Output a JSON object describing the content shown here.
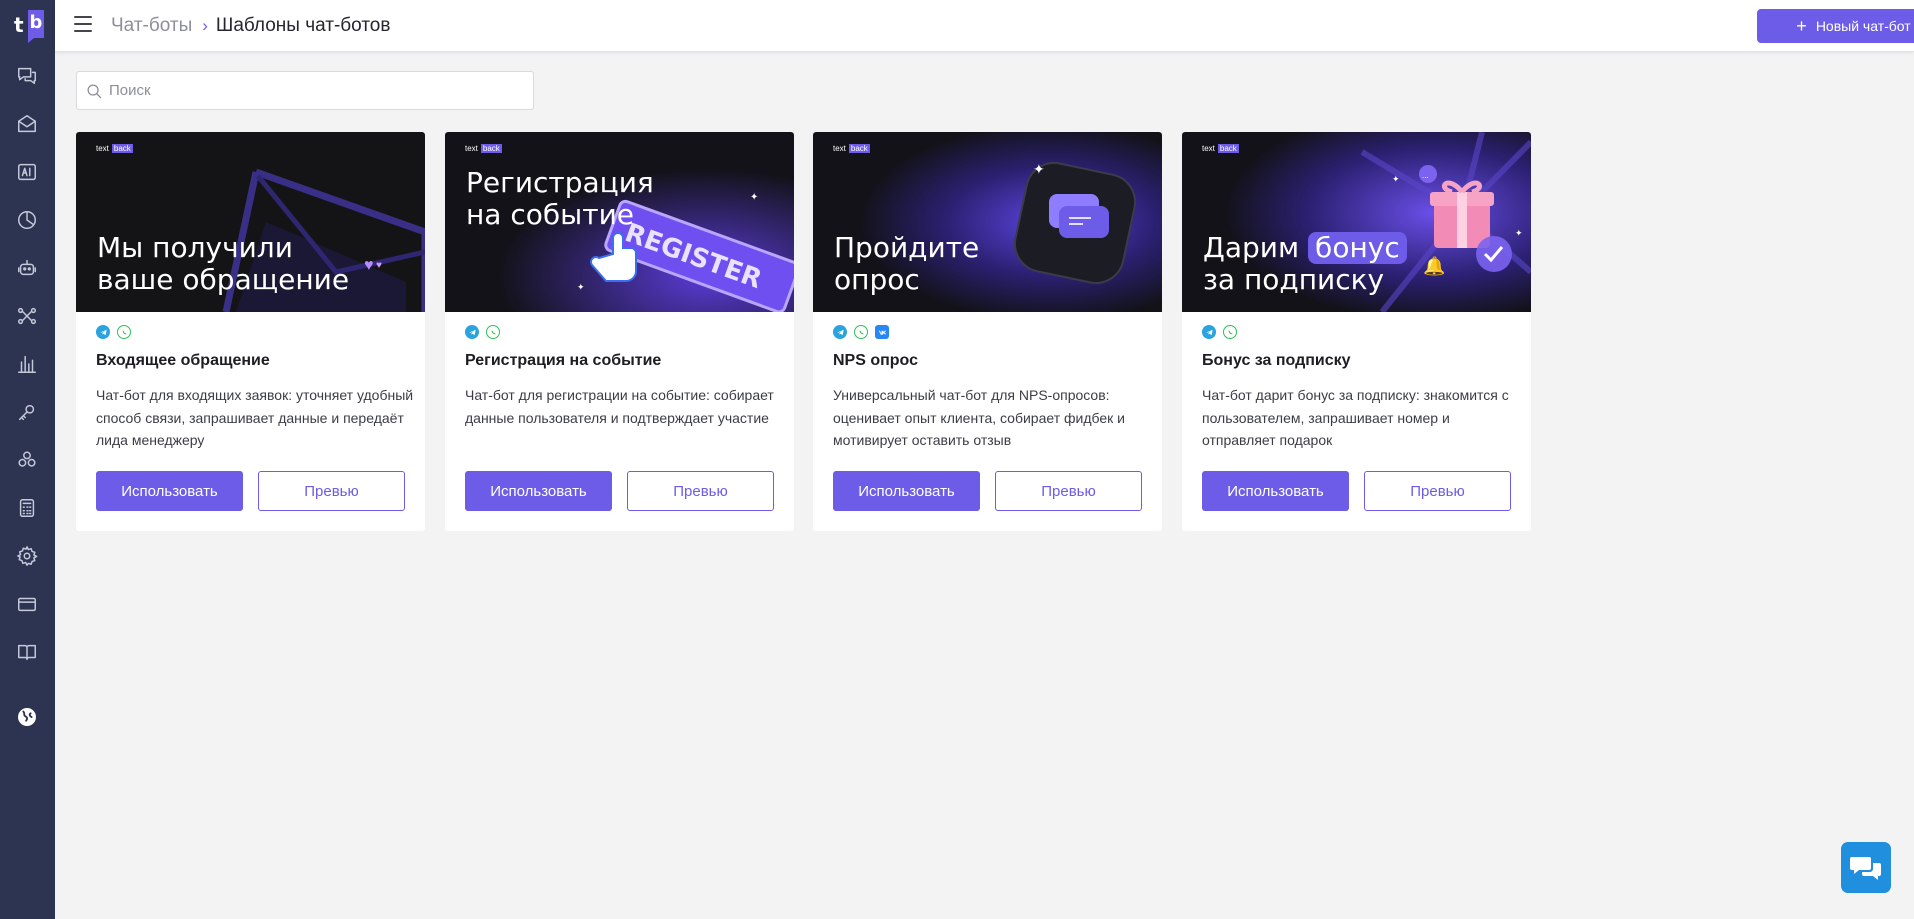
{
  "app": {
    "logo_t": "t",
    "logo_b": "b"
  },
  "sidebar": {
    "items": [
      {
        "name": "chats-icon"
      },
      {
        "name": "mailing-icon"
      },
      {
        "name": "ai-icon"
      },
      {
        "name": "analytics-icon"
      },
      {
        "name": "chatbot-icon"
      },
      {
        "name": "funnels-icon"
      },
      {
        "name": "statistics-icon"
      },
      {
        "name": "integrations-key-icon"
      },
      {
        "name": "widgets-icon"
      },
      {
        "name": "calculator-icon"
      },
      {
        "name": "settings-gear-icon"
      },
      {
        "name": "billing-card-icon"
      },
      {
        "name": "knowledge-book-icon"
      },
      {
        "name": "language-globe-icon"
      }
    ]
  },
  "header": {
    "breadcrumb_parent": "Чат-боты",
    "breadcrumb_separator": "›",
    "breadcrumb_current": "Шаблоны чат-ботов",
    "new_bot_plus": "+",
    "new_bot_label": "Новый чат-бот"
  },
  "search": {
    "placeholder": "Поиск",
    "value": ""
  },
  "brand": {
    "text": "text",
    "back": "back"
  },
  "cards": [
    {
      "banner_line1": "Мы получили",
      "banner_line2": "ваше обращение",
      "channels": [
        "telegram",
        "whatsapp"
      ],
      "title": "Входящее обращение",
      "description": "Чат-бот для входящих заявок: уточняет удобный способ связи, запрашивает данные и передаёт лида менеджеру",
      "use_label": "Использовать",
      "preview_label": "Превью"
    },
    {
      "banner_line1": "Регистрация",
      "banner_line2": "на событие",
      "banner_sign": "REGISTER",
      "channels": [
        "telegram",
        "whatsapp"
      ],
      "title": "Регистрация на событие",
      "description": "Чат-бот для регистрации на событие: собирает данные пользователя и подтверждает участие",
      "use_label": "Использовать",
      "preview_label": "Превью"
    },
    {
      "banner_line1": "Пройдите",
      "banner_line2": "опрос",
      "channels": [
        "telegram",
        "whatsapp",
        "vk"
      ],
      "title": "NPS опрос",
      "description": "Универсальный чат-бот для NPS-опросов: оценивает опыт клиента, собирает фидбек и мотивирует оставить отзыв",
      "use_label": "Использовать",
      "preview_label": "Превью"
    },
    {
      "banner_line1a": "Дарим",
      "banner_chip": "бонус",
      "banner_line2": "за подписку",
      "channels": [
        "telegram",
        "whatsapp"
      ],
      "title": "Бонус за подписку",
      "description": "Чат-бот дарит бонус за подписку: знакомится с пользователем, запрашивает номер и отправляет подарок",
      "use_label": "Использовать",
      "preview_label": "Превью"
    }
  ],
  "colors": {
    "accent": "#6c5ce7",
    "sidebar": "#2d3452",
    "chat_widget": "#1f8fde"
  }
}
